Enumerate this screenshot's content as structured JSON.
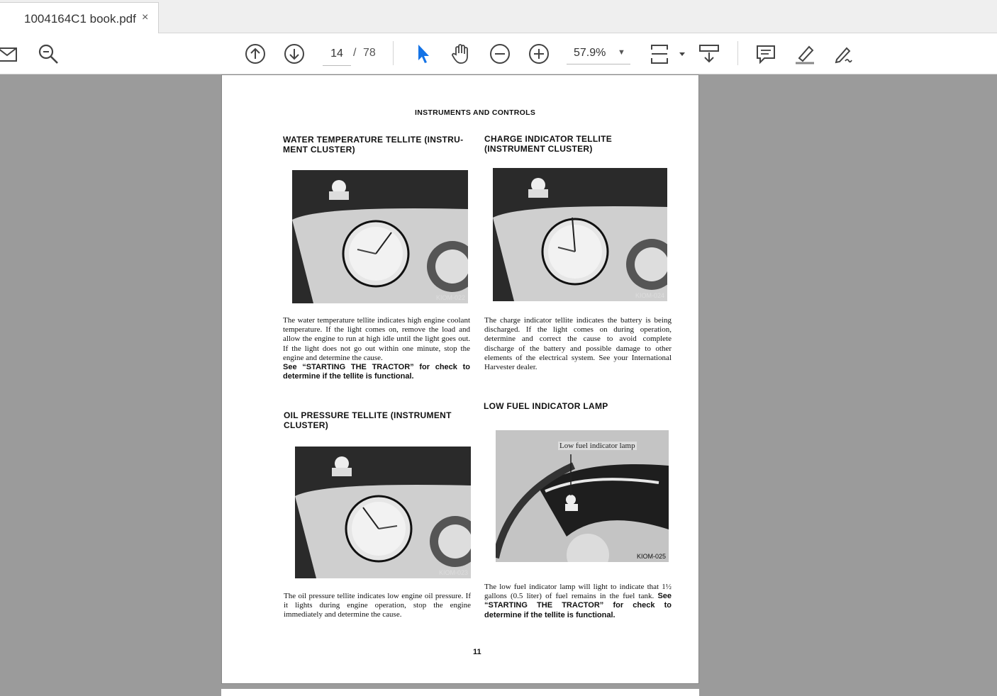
{
  "tab": {
    "title": "1004164C1 book.pdf",
    "close": "×"
  },
  "toolbar": {
    "page_current": "14",
    "page_sep": "/",
    "page_total": "78",
    "zoom": "57.9%",
    "icons": [
      "mail-icon",
      "search-icon",
      "page-up-icon",
      "page-down-icon",
      "select-cursor-icon",
      "hand-icon",
      "zoom-out-icon",
      "zoom-in-icon",
      "fit-page-icon",
      "scroll-mode-icon",
      "comment-icon",
      "highlight-icon",
      "sign-icon"
    ],
    "accent_color": "#1473e6"
  },
  "document": {
    "header": "INSTRUMENTS AND CONTROLS",
    "sections": [
      {
        "title": "WATER TEMPERATURE TELLITE (INSTRU-MENT CLUSTER)",
        "figure": "KIOM-022",
        "body": "The water temperature tellite indicates high engine coolant temperature. If the light comes on, remove the load and allow the engine to run at high idle until the light goes out. If the light does not go out within one minute, stop the engine and determine the cause.",
        "bold": "See “STARTING THE TRACTOR” for check to determine if the tellite is functional."
      },
      {
        "title": "CHARGE INDICATOR TELLITE (INSTRUMENT CLUSTER)",
        "figure": "KIOM-024",
        "body": "The charge indicator tellite indicates the battery is being discharged. If the light comes on during operation, determine and correct the cause to avoid complete discharge of the battery and possible damage to other elements of the electrical system. See your International Harvester dealer."
      },
      {
        "title": "OIL PRESSURE TELLITE (INSTRUMENT CLUSTER)",
        "figure": "KIOM-023",
        "body": "The oil pressure tellite indicates low engine oil pressure. If it lights during engine operation, stop the engine immediately and determine the cause."
      },
      {
        "title": "LOW FUEL INDICATOR LAMP",
        "figure": "KIOM-025",
        "photo_label": "Low fuel indicator lamp",
        "body": "The low fuel indicator lamp will light to indicate that 1½ gallons (0.5 liter) of fuel remains in the fuel tank.",
        "bold": "See “STARTING THE TRACTOR” for check to determine if the tellite is functional."
      }
    ],
    "page_number": "11"
  }
}
